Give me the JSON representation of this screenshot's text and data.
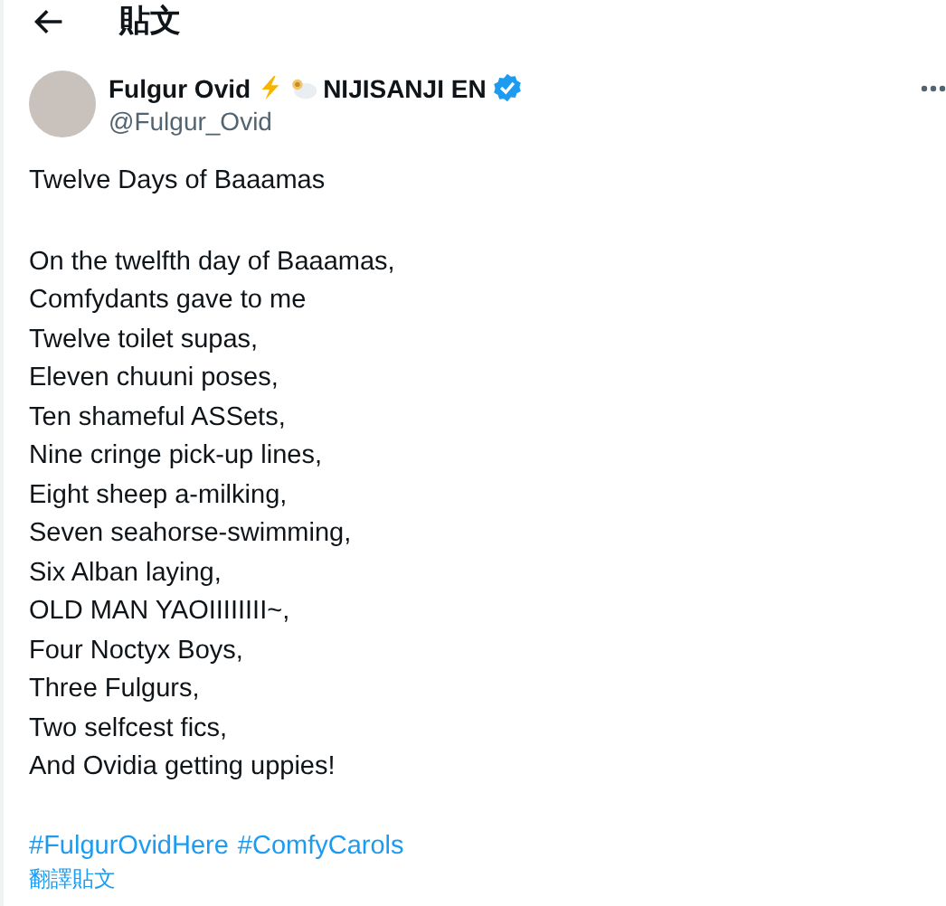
{
  "header": {
    "title": "貼文"
  },
  "author": {
    "name": "Fulgur Ovid",
    "org": "NIJISANJI EN",
    "handle": "@Fulgur_Ovid",
    "verified": true
  },
  "post": {
    "title": "Twelve Days of Baaamas",
    "lines": [
      "On the twelfth day of Baaamas,",
      "Comfydants gave to me",
      "Twelve toilet supas,",
      "Eleven chuuni poses,",
      "Ten shameful ASSets,",
      "Nine cringe pick-up lines,",
      "Eight sheep a-milking,",
      "Seven seahorse-swimming,",
      "Six Alban laying,",
      "OLD MAN YAOIIIIIIII~,",
      "Four Noctyx Boys,",
      "Three Fulgurs,",
      "Two selfcest fics,",
      "And Ovidia getting uppies!"
    ],
    "hashtags": [
      "#FulgurOvidHere",
      "#ComfyCarols"
    ],
    "translate": "翻譯貼文"
  }
}
